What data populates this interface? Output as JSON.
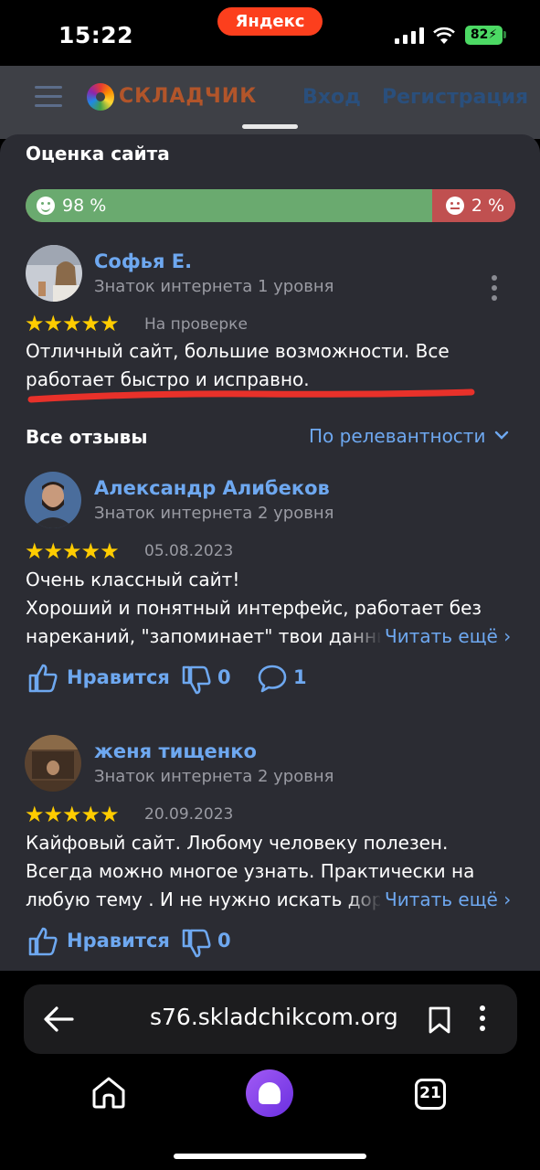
{
  "status_bar": {
    "time": "15:22",
    "pill": "Яндекс",
    "battery": "82"
  },
  "site_header": {
    "logo_text": "СКЛАДЧИК",
    "login": "Вход",
    "register": "Регистрация"
  },
  "rating": {
    "title": "Оценка сайта",
    "positive_label": "98 %",
    "negative_label": "2 %",
    "positive_fraction": 0.98,
    "positive_color": "#6aaa6f",
    "negative_color": "#c05050"
  },
  "my_review": {
    "author": "Софья Е.",
    "level": "Знаток интернета 1 уровня",
    "stars": "★★★★★",
    "status": "На проверке",
    "text": "Отличный сайт, большие возможности. Все\nработает быстро и исправно."
  },
  "all_reviews": {
    "title": "Все отзывы",
    "sort": "По релевантности"
  },
  "reviews": [
    {
      "author": "Александр Алибеков",
      "level": "Знаток интернета 2 уровня",
      "stars": "★★★★★",
      "date": "05.08.2023",
      "line1": "Очень классный сайт!",
      "line2": "Хороший и понятный интерфейс, работает без",
      "line3": "нареканий, \"запоминает\" твои данные",
      "read_more": "Читать ещё ›",
      "like": "Нравится",
      "dislikes": "0",
      "comments": "1"
    },
    {
      "author": "женя тищенко",
      "level": "Знаток интернета 2 уровня",
      "stars": "★★★★★",
      "date": "20.09.2023",
      "line1": "Кайфовый сайт. Любому человеку полезен.",
      "line2": "Всегда можно многое узнать. Практически на",
      "line3": "любую тему . И не нужно искать дорогих",
      "read_more": "Читать ещё ›",
      "like": "Нравится",
      "dislikes": "0"
    }
  ],
  "browser": {
    "url": "s76.skladchikcom.org",
    "tabs_count": "21"
  },
  "icons": {
    "back": "arrow-left-icon",
    "bookmark": "bookmark-icon",
    "menu": "more-vertical-icon",
    "home": "home-icon",
    "assistant": "alice-icon",
    "tabs": "tabs-icon",
    "like": "thumbs-up-icon",
    "dislike": "thumbs-down-icon",
    "comment": "comment-icon"
  }
}
